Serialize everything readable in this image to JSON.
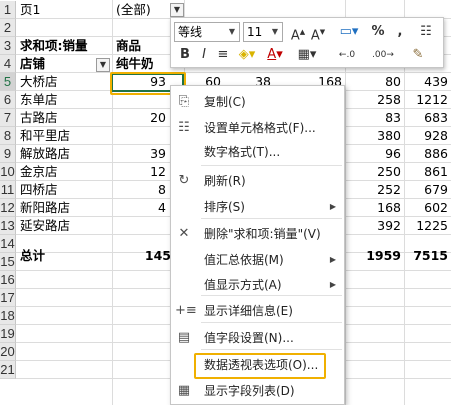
{
  "rows": [
    "1",
    "2",
    "3",
    "4",
    "5",
    "6",
    "7",
    "8",
    "9",
    "10",
    "11",
    "12",
    "13",
    "14",
    "15",
    "16",
    "17",
    "18",
    "19",
    "20",
    "21"
  ],
  "selected_row": "5",
  "row1": {
    "label": "页1",
    "value": "(全部)"
  },
  "row3": {
    "label": "求和项:销量",
    "col": "商品"
  },
  "row4": {
    "label": "店铺",
    "col": "纯牛奶"
  },
  "stores": [
    "大桥店",
    "东单店",
    "古路店",
    "和平里店",
    "解放路店",
    "金京店",
    "四桥店",
    "新阳路店",
    "延安路店"
  ],
  "partial_col_b": [
    "93",
    "",
    "20",
    "",
    "39",
    "12",
    "8",
    "4",
    ""
  ],
  "col_c5": "60",
  "col_d5": "38",
  "col_e5": "168",
  "col_f": [
    "80",
    "258",
    "83",
    "380",
    "96",
    "250",
    "252",
    "168",
    "392"
  ],
  "col_g": [
    "439",
    "1212",
    "683",
    "928",
    "886",
    "861",
    "679",
    "602",
    "1225"
  ],
  "total": {
    "label": "总计",
    "b": "145",
    "f": "1959",
    "g": "7515"
  },
  "minibar": {
    "font": "等线",
    "size": "11",
    "buttons": [
      "B",
      "I",
      "≡",
      "A",
      "A",
      "%",
      ","
    ]
  },
  "menu": {
    "items": [
      {
        "icon": "copy-icon",
        "glyph": "⎘",
        "label": "复制(C)"
      },
      {
        "icon": "format-cells-icon",
        "glyph": "☷",
        "label": "设置单元格格式(F)..."
      },
      {
        "icon": "",
        "glyph": "",
        "label": "数字格式(T)..."
      },
      {
        "icon": "refresh-icon",
        "glyph": "↻",
        "label": "刷新(R)"
      },
      {
        "icon": "",
        "glyph": "",
        "label": "排序(S)"
      },
      {
        "icon": "delete-icon",
        "glyph": "✕",
        "label": "删除\"求和项:销量\"(V)"
      },
      {
        "icon": "",
        "glyph": "",
        "label": "值汇总依据(M)"
      },
      {
        "icon": "",
        "glyph": "",
        "label": "值显示方式(A)"
      },
      {
        "icon": "show-detail-icon",
        "glyph": "+≡",
        "label": "显示详细信息(E)"
      },
      {
        "icon": "field-settings-icon",
        "glyph": "▤",
        "label": "值字段设置(N)..."
      },
      {
        "icon": "",
        "glyph": "",
        "label": "数据透视表选项(O)..."
      },
      {
        "icon": "field-list-icon",
        "glyph": "▦",
        "label": "显示字段列表(D)"
      }
    ]
  },
  "colors": {
    "highlight": "#f0b000",
    "active": "#217346"
  }
}
